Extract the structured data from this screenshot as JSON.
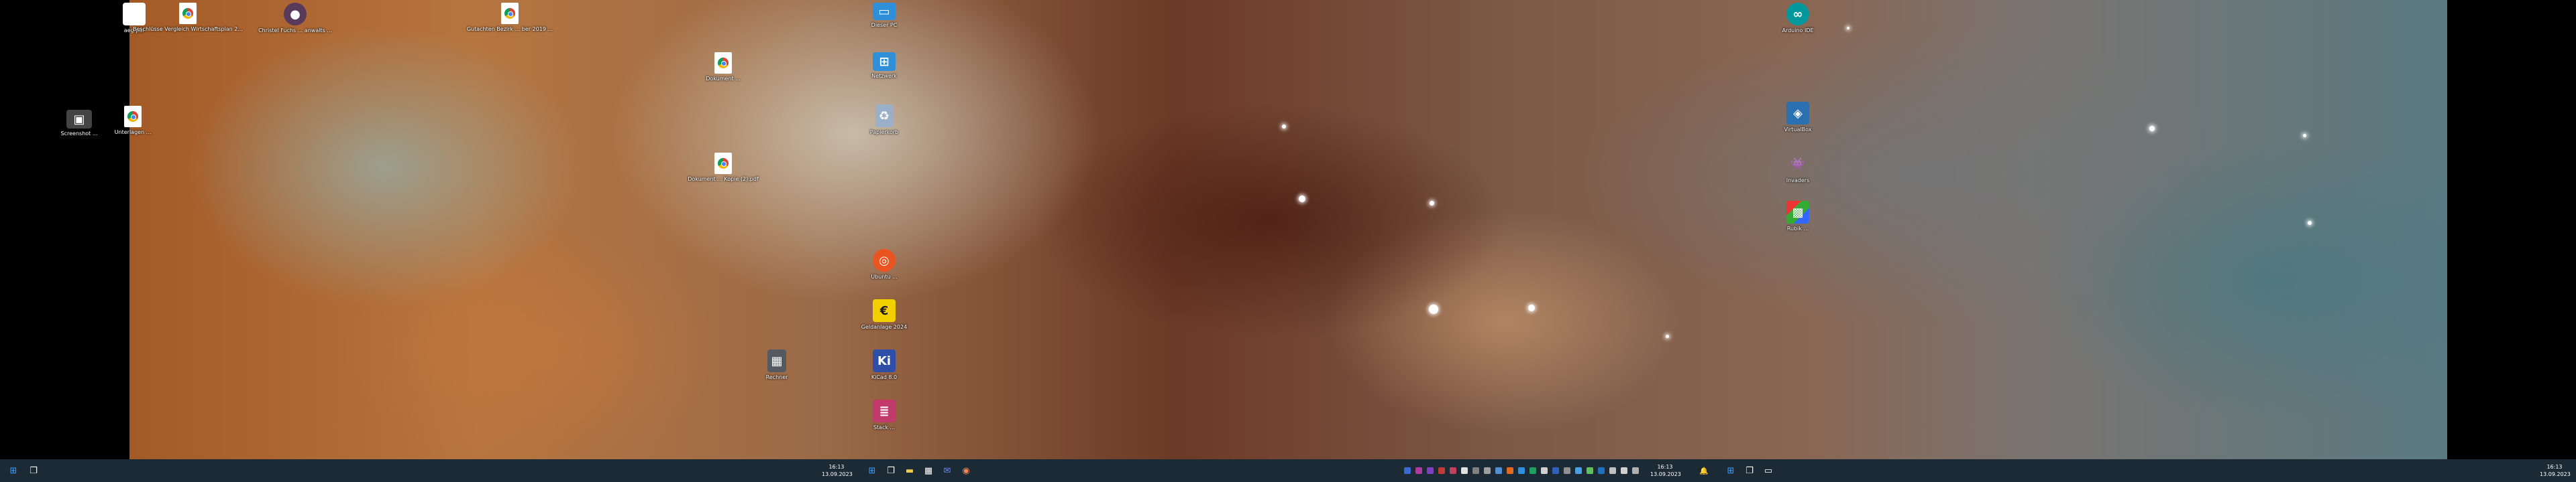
{
  "desktop": {
    "icons": [
      {
        "id": "file",
        "label": "aeg.pdf"
      },
      {
        "id": "chrome1",
        "label": "Beschlüsse Vergleich Wirtschaftsplan 2..."
      },
      {
        "id": "person",
        "label": "Christel Fuchs ... anwalts ..."
      },
      {
        "id": "chrome2",
        "label": "Gutachten Bezirk ... ber 2019 ..."
      },
      {
        "id": "chrome3",
        "label": "Dokument ..."
      },
      {
        "id": "chrome4",
        "label": "Dokument ... Kopie (2).pdf"
      },
      {
        "id": "monitor",
        "label": "Dieser PC"
      },
      {
        "id": "network",
        "label": "Netzwerk"
      },
      {
        "id": "recycle",
        "label": "Papierkorb"
      },
      {
        "id": "ubuntu",
        "label": "Ubuntu ..."
      },
      {
        "id": "euro",
        "label": "Geldanlage 2024"
      },
      {
        "id": "ki",
        "label": "KiCad 8.0"
      },
      {
        "id": "stack",
        "label": "Stack ..."
      },
      {
        "id": "calc",
        "label": "Rechner"
      },
      {
        "id": "arduino",
        "label": "Arduino IDE"
      },
      {
        "id": "cube",
        "label": "VirtualBox"
      },
      {
        "id": "invader",
        "label": "Invaders"
      },
      {
        "id": "rubik",
        "label": "Rubik ..."
      },
      {
        "id": "photo",
        "label": "Screenshot ..."
      },
      {
        "id": "chrome5",
        "label": "Unterlagen ..."
      }
    ]
  },
  "taskbar": {
    "left_clock": {
      "time": "16:13",
      "date": "13.09.2023"
    },
    "mid_clock": {
      "time": "16:13",
      "date": "13.09.2023"
    },
    "right_clock": {
      "time": "16:13",
      "date": "13.09.2023"
    },
    "start_icon": "windows-start-icon",
    "taskview_icon": "task-view-icon"
  },
  "colors": {
    "taskbar_bg": "#1c2a36",
    "accent": "#3aa0ff"
  }
}
